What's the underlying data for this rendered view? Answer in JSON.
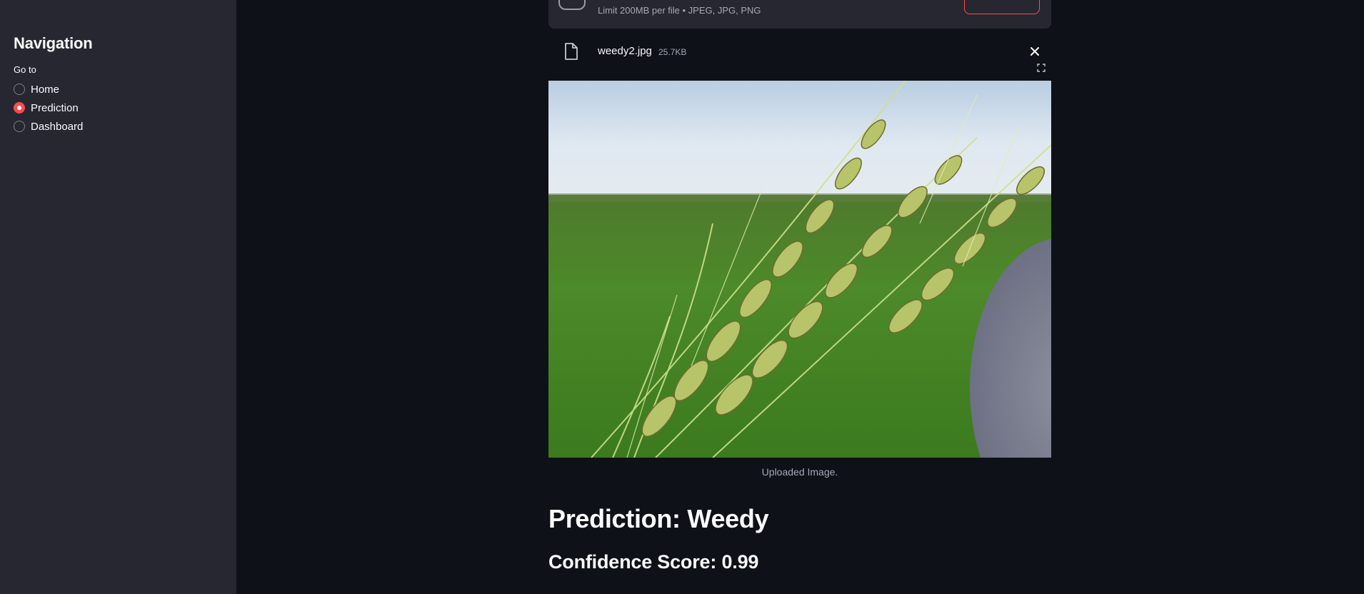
{
  "sidebar": {
    "title": "Navigation",
    "radio_label": "Go to",
    "options": [
      {
        "label": "Home",
        "selected": false
      },
      {
        "label": "Prediction",
        "selected": true
      },
      {
        "label": "Dashboard",
        "selected": false
      }
    ]
  },
  "uploader": {
    "limit_text": "Limit 200MB per file • JPEG, JPG, PNG",
    "icon": "upload-cloud-icon"
  },
  "file": {
    "name": "weedy2.jpg",
    "size": "25.7KB",
    "icon": "file-icon"
  },
  "image": {
    "caption": "Uploaded Image."
  },
  "result": {
    "prediction": "Prediction: Weedy",
    "confidence": "Confidence Score: 0.99"
  },
  "colors": {
    "background": "#0e1117",
    "sidebar": "#262730",
    "accent": "#ff4b4b",
    "text": "#fafafa",
    "muted": "#a3a8b8"
  }
}
